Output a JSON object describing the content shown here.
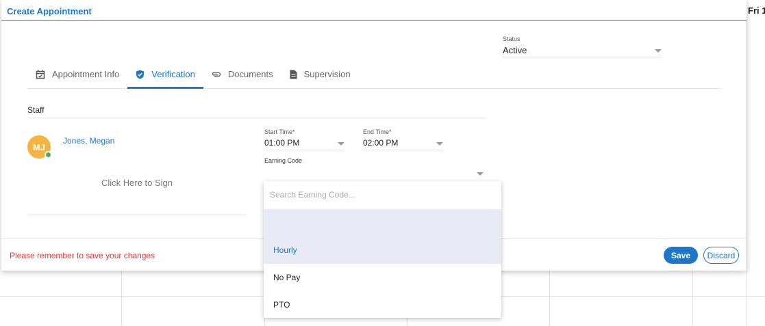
{
  "background": {
    "day_header": "Fri 1("
  },
  "modal": {
    "title": "Create Appointment",
    "status": {
      "label": "Status",
      "value": "Active"
    },
    "tabs": [
      {
        "label": "Appointment Info",
        "icon": "calendar-check-icon",
        "active": false
      },
      {
        "label": "Verification",
        "icon": "shield-check-icon",
        "active": true
      },
      {
        "label": "Documents",
        "icon": "paperclip-icon",
        "active": false
      },
      {
        "label": "Supervision",
        "icon": "document-icon",
        "active": false
      }
    ],
    "staff": {
      "section_label": "Staff",
      "initials": "MJ",
      "name": "Jones, Megan",
      "online": true,
      "sign_text": "Click Here to Sign"
    },
    "start_time": {
      "label": "Start Time",
      "required": "*",
      "value": "01:00 PM"
    },
    "end_time": {
      "label": "End Time",
      "required": "*",
      "value": "02:00 PM"
    },
    "earning_code": {
      "label": "Earning Code",
      "value": "",
      "search_placeholder": "Search Earning Code...",
      "options": [
        "",
        "Hourly",
        "No Pay",
        "PTO"
      ],
      "highlighted": "Hourly"
    },
    "footer": {
      "reminder": "Please remember to save your changes",
      "save_label": "Save",
      "discard_label": "Discard"
    }
  },
  "colors": {
    "accent": "#1e76c9",
    "warning": "#e53935",
    "avatar": "#f5b342",
    "online": "#4caf50"
  }
}
